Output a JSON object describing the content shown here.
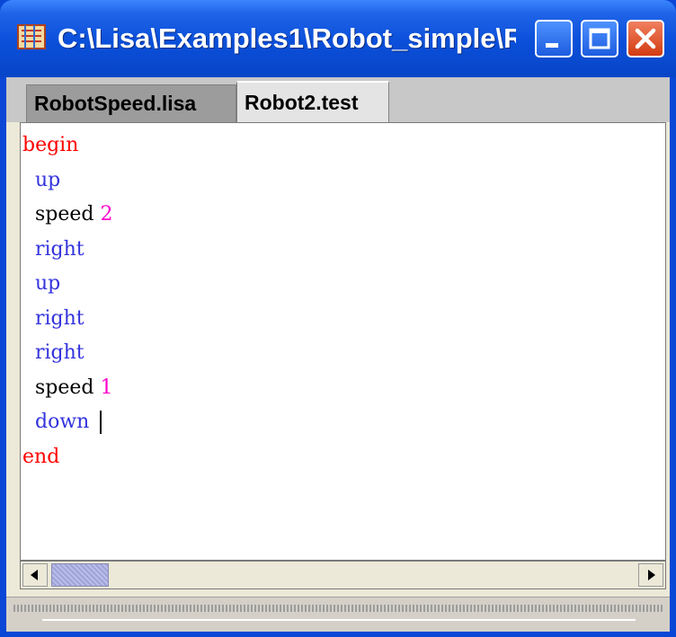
{
  "window": {
    "title": "C:\\Lisa\\Examples1\\Robot_simple\\R..."
  },
  "titlebar_buttons": {
    "minimize_icon": "minimize-icon",
    "maximize_icon": "maximize-icon",
    "close_icon": "close-icon"
  },
  "tabs": [
    {
      "label": "RobotSpeed.lisa",
      "active": false
    },
    {
      "label": "Robot2.test",
      "active": true
    }
  ],
  "editor": {
    "lines": [
      {
        "indent": "",
        "keyword": "begin",
        "value": ""
      },
      {
        "indent": "  ",
        "keyword": "up",
        "value": ""
      },
      {
        "indent": "  ",
        "keyword": "speed",
        "value": "2"
      },
      {
        "indent": "  ",
        "keyword": "right",
        "value": ""
      },
      {
        "indent": "  ",
        "keyword": "up",
        "value": ""
      },
      {
        "indent": "  ",
        "keyword": "right",
        "value": ""
      },
      {
        "indent": "  ",
        "keyword": "right",
        "value": ""
      },
      {
        "indent": "  ",
        "keyword": "speed",
        "value": "1"
      },
      {
        "indent": "  ",
        "keyword": "down",
        "value": ""
      },
      {
        "indent": "",
        "keyword": "end",
        "value": ""
      }
    ],
    "caret_line": 8
  },
  "colors": {
    "block_keyword": "#ff0000",
    "move_keyword": "#3333dd",
    "speed_keyword": "#000000",
    "number": "#ff00cc",
    "titlebar": "#0a4fd9"
  }
}
